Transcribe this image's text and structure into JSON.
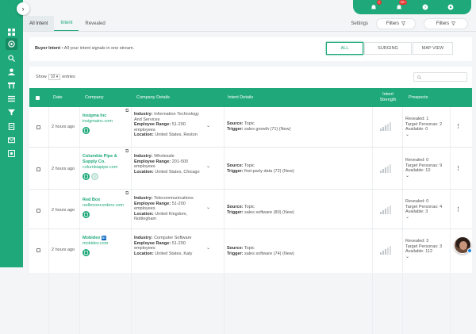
{
  "topbar": {
    "notif_badge_1": "1",
    "notif_badge_2": "99+"
  },
  "tabs": {
    "all_intent": "All Intent",
    "intent": "Intent",
    "revealed": "Revealed",
    "settings": "Settings",
    "filters1": "Filters",
    "filters2": "Filters"
  },
  "card": {
    "title": "Buyer Intent",
    "subtitle": " • All your intent signals in one stream.",
    "seg_all": "ALL",
    "seg_surging": "SURGING",
    "seg_map": "MAP VIEW"
  },
  "table": {
    "show": "Show",
    "show_value": "10",
    "entries": "entries",
    "headers": {
      "date": "Date",
      "company": "Company",
      "details": "Company Details",
      "intent": "Intent Details",
      "strength": "Intent Strength",
      "prospects": "Prospects"
    },
    "labels": {
      "industry": "Industry",
      "employee_range": "Employee Range",
      "location": "Location",
      "source": "Source",
      "trigger": "Trigger",
      "revealed": "Revealed",
      "target_personas": "Target Personas",
      "available": "Available"
    },
    "rows": [
      {
        "date": "2 hours ago",
        "name": "Insigma Inc",
        "domain": "insigmainc.com",
        "industry": " Information Technology And Services",
        "employees": " 51-200",
        "emp_suffix": "employees",
        "location": " United States, Reston",
        "source": " Topic",
        "trigger": " sales growth (71) (New)",
        "revealed": " 1",
        "personas": " 2",
        "available": " 0",
        "strength": 3
      },
      {
        "date": "2 hours ago",
        "name": "Columbia Pipe & Supply Co.",
        "domain": "columbiapipe.com",
        "industry": " Wholesale",
        "employees": " 201-500",
        "emp_suffix": "employees",
        "location": " United States, Chicago",
        "source": " Topic",
        "trigger": " first-party data (72) (New)",
        "revealed": " 0",
        "personas": " 9",
        "available": " 10",
        "strength": 3
      },
      {
        "date": "2 hours ago",
        "name": "Red Box",
        "domain": "redboxrecorders.com",
        "industry": " Telecommunications",
        "employees": " 51-200",
        "emp_suffix": "employees",
        "location": " United Kingdom, Nottingham",
        "source": " Topic",
        "trigger": " sales software (80) (New)",
        "revealed": " 0",
        "personas": " 4",
        "available": " 3",
        "strength": 3
      },
      {
        "date": "2 hours ago",
        "name": "Mobidev",
        "domain": "mobidev.com",
        "industry": " Computer Software",
        "employees": " 51-200",
        "emp_suffix": "employees",
        "location": " United States, Katy",
        "source": " Topic",
        "trigger": " sales software (74) (New)",
        "revealed": " 3",
        "personas": " 3",
        "available": " 112",
        "strength": 3
      }
    ]
  },
  "colors": {
    "brand": "#1fa97a",
    "badge": "#e53935"
  }
}
